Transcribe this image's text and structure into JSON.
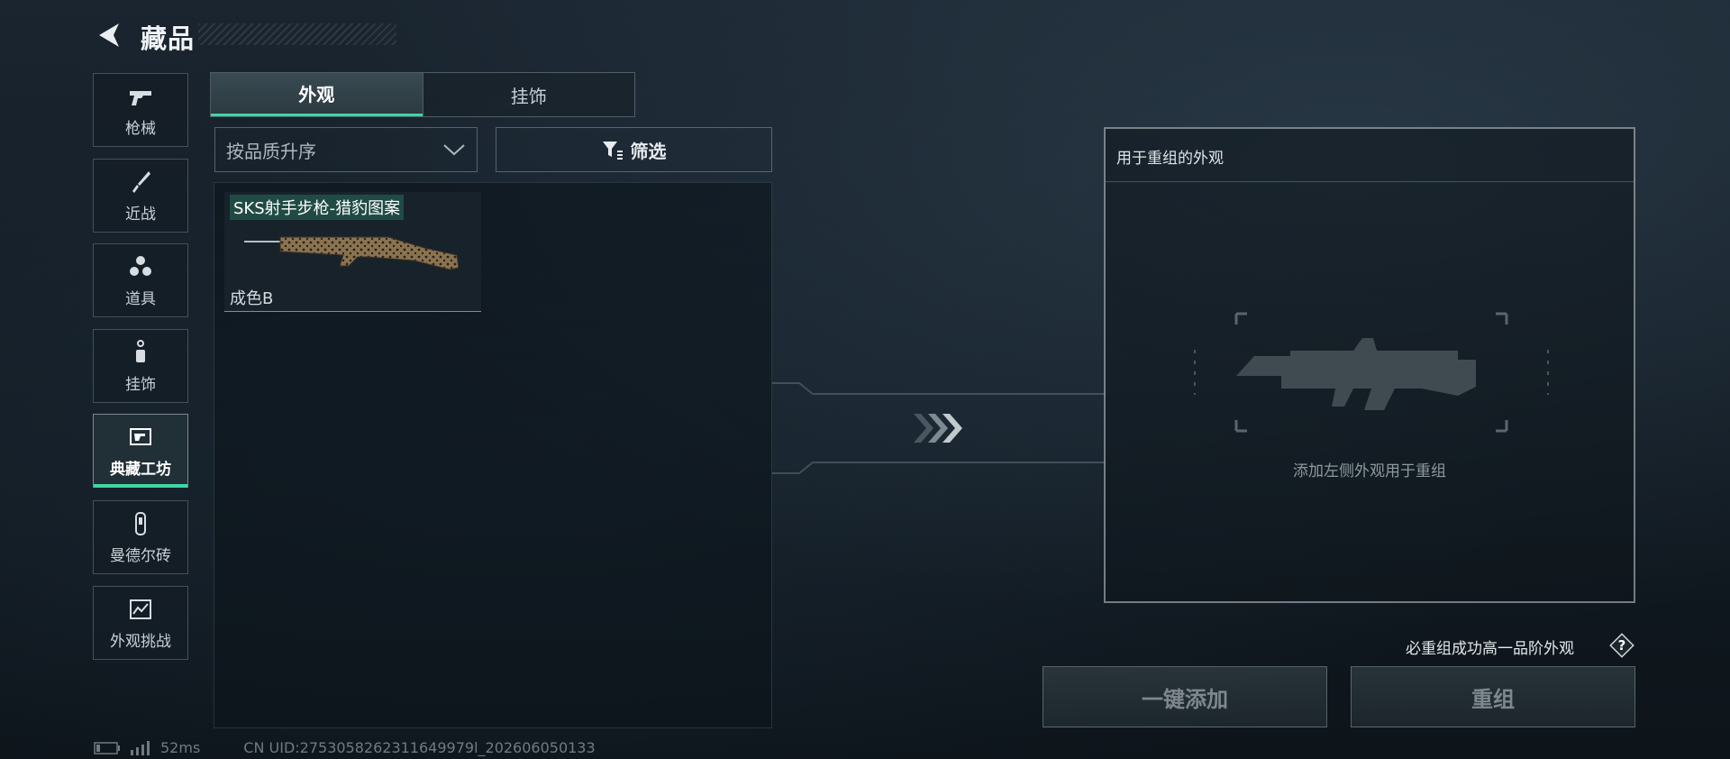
{
  "header": {
    "title": "藏品"
  },
  "sidebar": {
    "items": [
      {
        "label": "枪械",
        "icon": "pistol-icon",
        "active": false
      },
      {
        "label": "近战",
        "icon": "knife-icon",
        "active": false
      },
      {
        "label": "道具",
        "icon": "grenades-icon",
        "active": false
      },
      {
        "label": "挂饰",
        "icon": "charm-icon",
        "active": false
      },
      {
        "label": "典藏工坊",
        "icon": "workshop-icon",
        "active": true
      },
      {
        "label": "曼德尔砖",
        "icon": "brick-icon",
        "active": false
      },
      {
        "label": "外观挑战",
        "icon": "challenge-icon",
        "active": false
      }
    ]
  },
  "tabs": [
    {
      "label": "外观",
      "active": true
    },
    {
      "label": "挂饰",
      "active": false
    }
  ],
  "sort": {
    "value": "按品质升序"
  },
  "filter": {
    "label": "筛选"
  },
  "skins": [
    {
      "name": "SKS射手步枪-猎豹图案",
      "grade": "成色B"
    }
  ],
  "recompose_panel": {
    "title": "用于重组的外观",
    "hint": "添加左侧外观用于重组"
  },
  "upgrade_note": "必重组成功高一品阶外观",
  "buttons": {
    "one_key_add": "一键添加",
    "recompose": "重组"
  },
  "status": {
    "ping": "52ms",
    "uid": "CN UID:2753058262311649979l_202606050133"
  },
  "colors": {
    "accent": "#3fd6a3"
  }
}
